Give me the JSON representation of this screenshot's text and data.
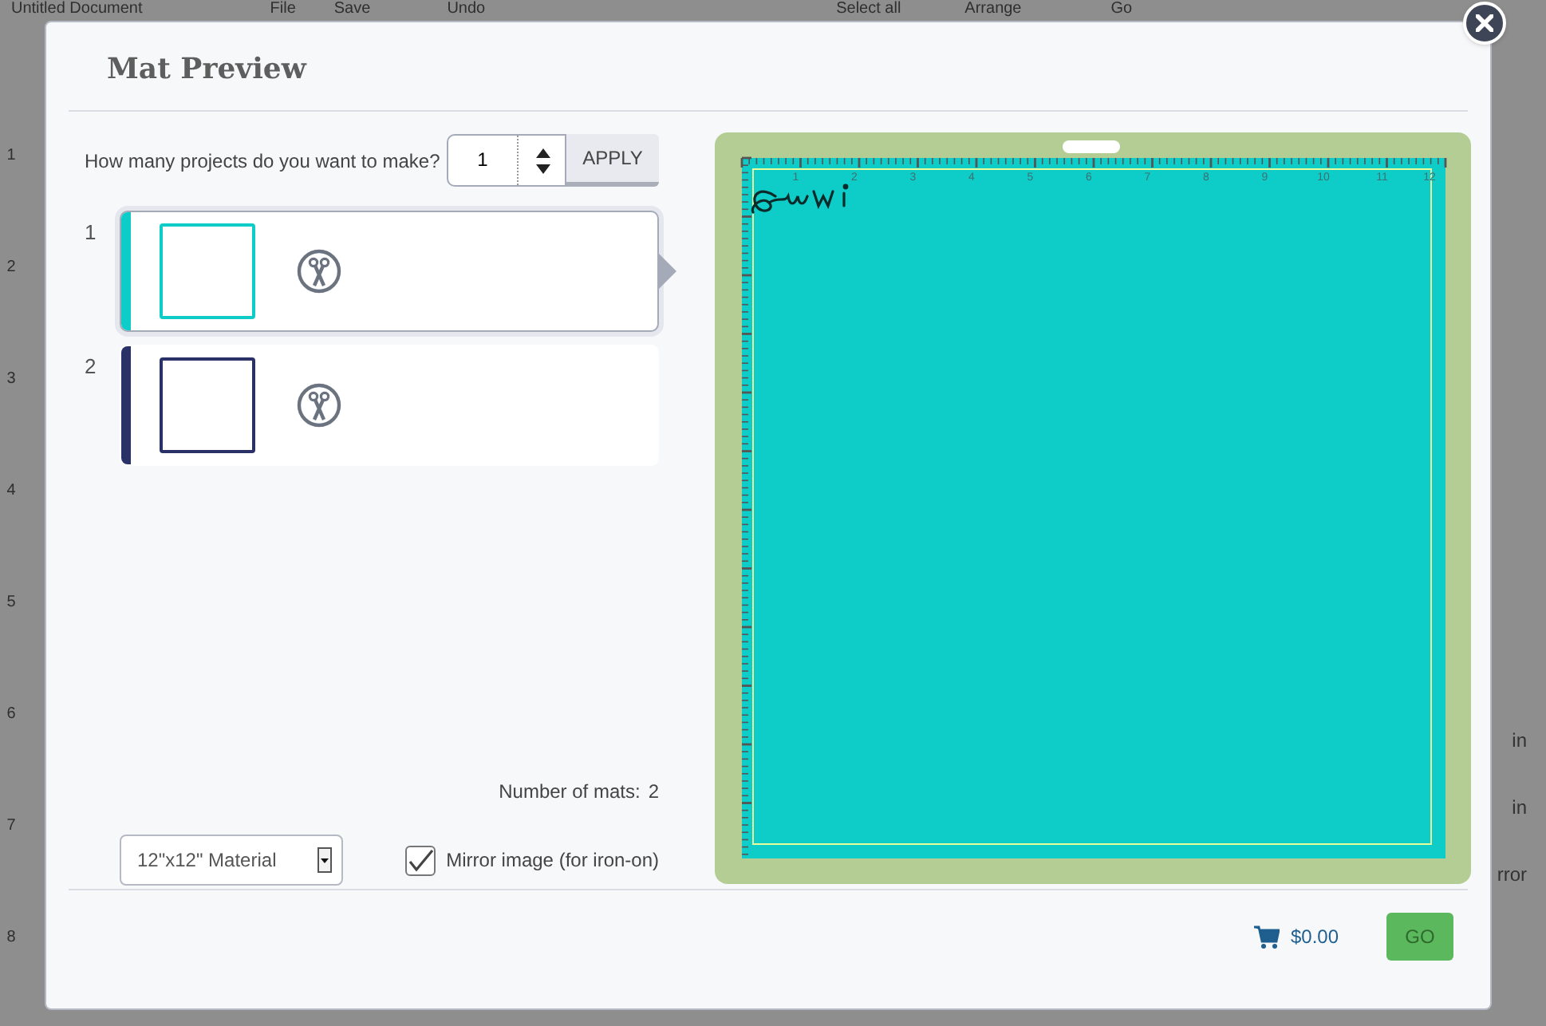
{
  "background": {
    "top_bar": [
      "Untitled Document",
      "File",
      "Save",
      "Undo",
      "Select all",
      "Arrange",
      "Go"
    ],
    "ruler": [
      "1",
      "2",
      "3",
      "4",
      "5",
      "6",
      "7",
      "8"
    ],
    "side_labels": [
      "in",
      "in",
      "rror"
    ]
  },
  "dialog": {
    "title": "Mat Preview",
    "quantity": {
      "label": "How many projects do you want to make?",
      "value": "1",
      "apply": "APPLY"
    },
    "mats": [
      {
        "number": "1",
        "selected": true,
        "color": "#0ecdc9"
      },
      {
        "number": "2",
        "selected": false,
        "color": "#2a3167"
      }
    ],
    "mat_count": {
      "label": "Number of mats:",
      "value": "2"
    },
    "material": {
      "value": "12\"x12\" Material"
    },
    "mirror": {
      "label": "Mirror image (for iron-on)",
      "checked": true
    },
    "preview": {
      "ruler": [
        "1",
        "2",
        "3",
        "4",
        "5",
        "6",
        "7",
        "8",
        "9",
        "10",
        "11",
        "12"
      ]
    },
    "footer": {
      "price": "$0.00",
      "go": "GO"
    }
  }
}
